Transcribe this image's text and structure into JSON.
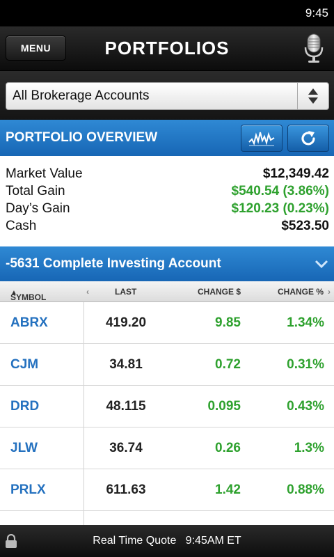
{
  "status_bar": {
    "time": "9:45"
  },
  "header": {
    "menu_label": "MENU",
    "title": "PORTFOLIOS"
  },
  "account_selector": {
    "value": "All Brokerage Accounts"
  },
  "overview": {
    "title": "PORTFOLIO OVERVIEW",
    "rows": [
      {
        "label": "Market Value",
        "value": "$12,349.42",
        "color": "#111111"
      },
      {
        "label": "Total Gain",
        "value": "$540.54 (3.86%)",
        "color": "#2ea12e"
      },
      {
        "label": "Day’s Gain",
        "value": "$120.23 (0.23%)",
        "color": "#2ea12e"
      },
      {
        "label": "Cash",
        "value": "$523.50",
        "color": "#111111"
      }
    ]
  },
  "account": {
    "title": "-5631 Complete Investing Account"
  },
  "table": {
    "columns": {
      "symbol": "SYMBOL",
      "last": "LAST",
      "change_dollar": "CHANGE $",
      "change_pct": "CHANGE %"
    },
    "rows": [
      {
        "symbol": "ABRX",
        "last": "419.20",
        "change": "9.85",
        "pct": "1.34%"
      },
      {
        "symbol": "CJM",
        "last": "34.81",
        "change": "0.72",
        "pct": "0.31%"
      },
      {
        "symbol": "DRD",
        "last": "48.115",
        "change": "0.095",
        "pct": "0.43%"
      },
      {
        "symbol": "JLW",
        "last": "36.74",
        "change": "0.26",
        "pct": "1.3%"
      },
      {
        "symbol": "PRLX",
        "last": "611.63",
        "change": "1.42",
        "pct": "0.88%"
      }
    ]
  },
  "footer": {
    "text": "Real Time Quote   9:45AM ET"
  },
  "colors": {
    "accent_blue": "#1f77c8",
    "gain_green": "#2ea12e",
    "symbol_blue": "#2471bf"
  }
}
